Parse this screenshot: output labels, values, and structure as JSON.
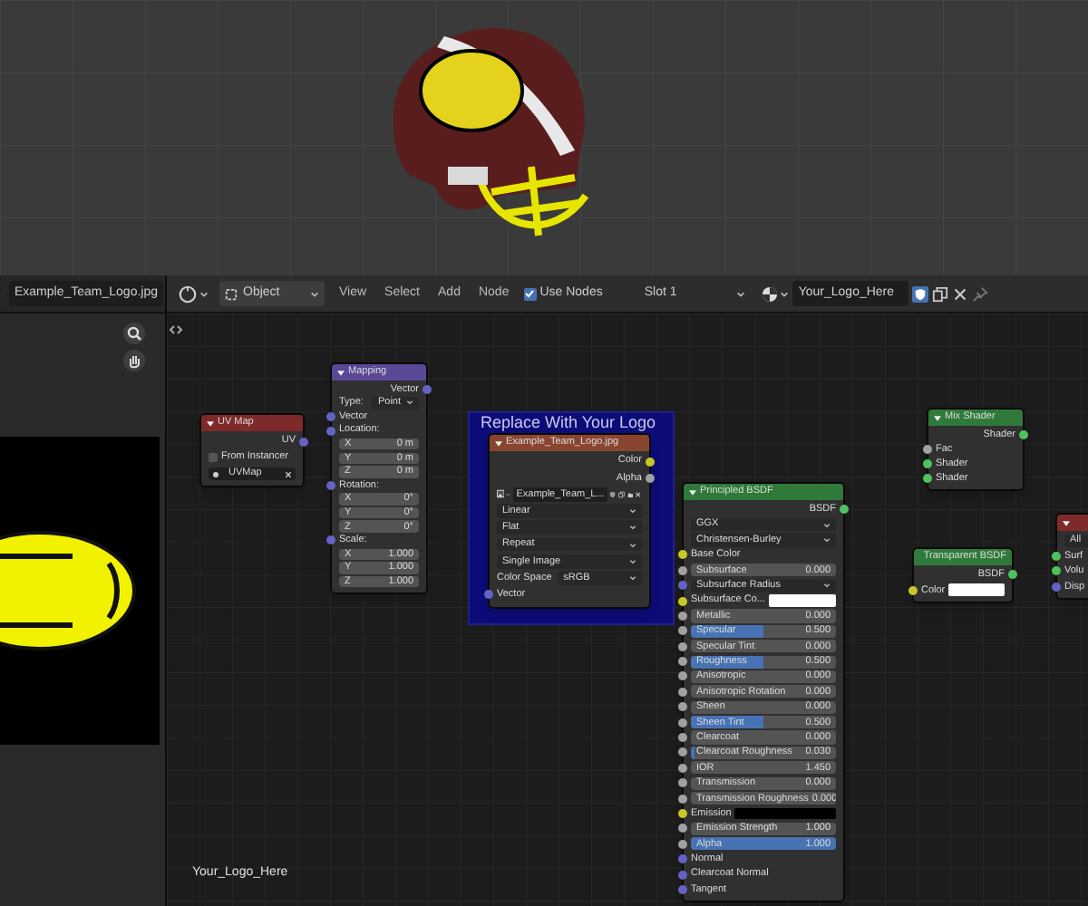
{
  "image_editor": {
    "image_name": "Example_Team_Logo.jpg"
  },
  "node_header": {
    "mode": "Object",
    "menus": [
      "View",
      "Select",
      "Add",
      "Node"
    ],
    "use_nodes": {
      "label": "Use Nodes",
      "checked": true
    },
    "slot": "Slot 1",
    "material": "Your_Logo_Here",
    "fake_user": true
  },
  "frame": {
    "label": "Replace With Your Logo"
  },
  "nodes": [
    {
      "title": "UV Map",
      "color": "#7f2a2a",
      "rows": [
        {
          "kind": "output",
          "label": "UV",
          "color": "#6363c7"
        },
        {
          "kind": "checkbox",
          "label": "From Instancer",
          "checked": false
        },
        {
          "kind": "field",
          "value": "UVMap"
        }
      ]
    },
    {
      "title": "Mapping",
      "color": "#5a4796",
      "rows": [
        {
          "kind": "output",
          "label": "Vector",
          "color": "#6363c7"
        },
        {
          "kind": "dropdown",
          "label": "Type:",
          "value": "Point"
        },
        {
          "kind": "input",
          "label": "Vector",
          "color": "#6363c7"
        },
        {
          "kind": "group",
          "label": "Location:",
          "color": "#6363c7"
        },
        {
          "kind": "value",
          "label": "X",
          "value": "0 m"
        },
        {
          "kind": "value",
          "label": "Y",
          "value": "0 m"
        },
        {
          "kind": "value",
          "label": "Z",
          "value": "0 m"
        },
        {
          "kind": "group",
          "label": "Rotation:",
          "color": "#6363c7"
        },
        {
          "kind": "value",
          "label": "X",
          "value": "0°"
        },
        {
          "kind": "value",
          "label": "Y",
          "value": "0°"
        },
        {
          "kind": "value",
          "label": "Z",
          "value": "0°"
        },
        {
          "kind": "group",
          "label": "Scale:",
          "color": "#6363c7"
        },
        {
          "kind": "value",
          "label": "X",
          "value": "1.000"
        },
        {
          "kind": "value",
          "label": "Y",
          "value": "1.000"
        },
        {
          "kind": "value",
          "label": "Z",
          "value": "1.000"
        }
      ]
    },
    {
      "title": "Example_Team_Logo.jpg",
      "color": "#8a4530",
      "rows": [
        {
          "kind": "output",
          "label": "Color",
          "color": "#c7c729"
        },
        {
          "kind": "output",
          "label": "Alpha",
          "color": "#a1a1a1"
        },
        {
          "kind": "image",
          "value": "Example_Team_L..."
        },
        {
          "kind": "dropdown",
          "value": "Linear"
        },
        {
          "kind": "dropdown",
          "value": "Flat"
        },
        {
          "kind": "dropdown",
          "value": "Repeat"
        },
        {
          "kind": "dropdown",
          "value": "Single Image"
        },
        {
          "kind": "dropdown",
          "label": "Color Space",
          "value": "sRGB"
        },
        {
          "kind": "input",
          "label": "Vector",
          "color": "#6363c7"
        }
      ]
    },
    {
      "title": "Principled BSDF",
      "color": "#2f7a3a",
      "rows": [
        {
          "kind": "output",
          "label": "BSDF",
          "color": "#4fc25f"
        },
        {
          "kind": "dropdown",
          "value": "GGX"
        },
        {
          "kind": "dropdown",
          "value": "Christensen-Burley"
        },
        {
          "kind": "input",
          "label": "Base Color",
          "color": "#c7c729"
        },
        {
          "kind": "value",
          "label": "Subsurface",
          "value": "0.000",
          "color": "#a1a1a1"
        },
        {
          "kind": "dropdown",
          "value": "Subsurface Radius",
          "color": "#6363c7"
        },
        {
          "kind": "color",
          "label": "Subsurface Co...",
          "color": "#ffffff"
        },
        {
          "kind": "value",
          "label": "Metallic",
          "value": "0.000",
          "color": "#a1a1a1"
        },
        {
          "kind": "value",
          "label": "Specular",
          "value": "0.500",
          "level": 0.5,
          "color": "#a1a1a1"
        },
        {
          "kind": "value",
          "label": "Specular Tint",
          "value": "0.000",
          "color": "#a1a1a1"
        },
        {
          "kind": "value",
          "label": "Roughness",
          "value": "0.500",
          "level": 0.5,
          "color": "#a1a1a1"
        },
        {
          "kind": "value",
          "label": "Anisotropic",
          "value": "0.000",
          "color": "#a1a1a1"
        },
        {
          "kind": "value",
          "label": "Anisotropic Rotation",
          "value": "0.000",
          "color": "#a1a1a1"
        },
        {
          "kind": "value",
          "label": "Sheen",
          "value": "0.000",
          "color": "#a1a1a1"
        },
        {
          "kind": "value",
          "label": "Sheen Tint",
          "value": "0.500",
          "level": 0.5,
          "color": "#a1a1a1"
        },
        {
          "kind": "value",
          "label": "Clearcoat",
          "value": "0.000",
          "color": "#a1a1a1"
        },
        {
          "kind": "value",
          "label": "Clearcoat Roughness",
          "value": "0.030",
          "level": 0.03,
          "color": "#a1a1a1"
        },
        {
          "kind": "value",
          "label": "IOR",
          "value": "1.450",
          "color": "#a1a1a1"
        },
        {
          "kind": "value",
          "label": "Transmission",
          "value": "0.000",
          "color": "#a1a1a1"
        },
        {
          "kind": "value",
          "label": "Transmission Roughness",
          "value": "0.000",
          "color": "#a1a1a1"
        },
        {
          "kind": "color",
          "label": "Emission",
          "color": "#000000"
        },
        {
          "kind": "value",
          "label": "Emission Strength",
          "value": "1.000",
          "color": "#a1a1a1"
        },
        {
          "kind": "value",
          "label": "Alpha",
          "value": "1.000",
          "level": 1,
          "color": "#a1a1a1"
        },
        {
          "kind": "input",
          "label": "Normal",
          "color": "#6363c7"
        },
        {
          "kind": "input",
          "label": "Clearcoat Normal",
          "color": "#6363c7"
        },
        {
          "kind": "input",
          "label": "Tangent",
          "color": "#6363c7"
        }
      ]
    },
    {
      "title": "Mix Shader",
      "color": "#2f7a3a",
      "rows": [
        {
          "kind": "output",
          "label": "Shader",
          "color": "#4fc25f"
        },
        {
          "kind": "input",
          "label": "Fac",
          "color": "#a1a1a1"
        },
        {
          "kind": "input",
          "label": "Shader",
          "color": "#4fc25f"
        },
        {
          "kind": "input",
          "label": "Shader",
          "color": "#4fc25f"
        }
      ]
    },
    {
      "title": "Transparent BSDF",
      "color": "#2f7a3a",
      "rows": [
        {
          "kind": "output",
          "label": "BSDF",
          "color": "#4fc25f"
        },
        {
          "kind": "color",
          "label": "Color",
          "color": "#ffffff"
        }
      ]
    },
    {
      "color": "#7f2a2a",
      "rows": [
        {
          "kind": "dropdown",
          "value": "All"
        },
        {
          "kind": "input",
          "label": "Surf",
          "color": "#4fc25f"
        },
        {
          "kind": "input",
          "label": "Volu",
          "color": "#4fc25f"
        },
        {
          "kind": "input",
          "label": "Disp",
          "color": "#6363c7"
        }
      ]
    }
  ],
  "material_label": "Your_Logo_Here"
}
